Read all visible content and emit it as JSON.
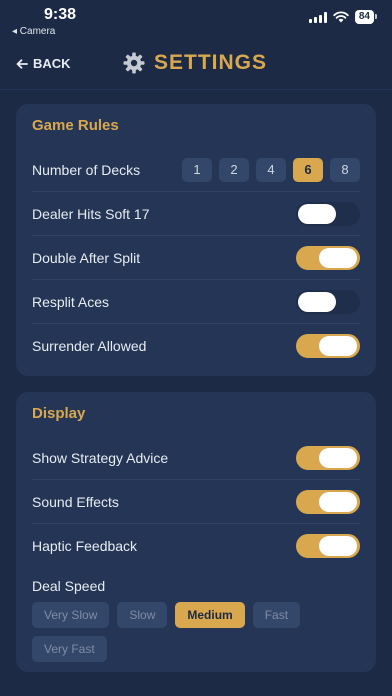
{
  "status_bar": {
    "time": "9:38",
    "back_app": "◂ Camera",
    "battery": "84"
  },
  "header": {
    "back_label": "BACK",
    "title": "SETTINGS",
    "accent_color": "#d9a84e"
  },
  "game_rules": {
    "title": "Game Rules",
    "decks": {
      "label": "Number of Decks",
      "options": [
        "1",
        "2",
        "4",
        "6",
        "8"
      ],
      "selected": "6"
    },
    "toggles": [
      {
        "label": "Dealer Hits Soft 17",
        "on": false
      },
      {
        "label": "Double After Split",
        "on": true
      },
      {
        "label": "Resplit Aces",
        "on": false
      },
      {
        "label": "Surrender Allowed",
        "on": true
      }
    ]
  },
  "display": {
    "title": "Display",
    "toggles": [
      {
        "label": "Show Strategy Advice",
        "on": true
      },
      {
        "label": "Sound Effects",
        "on": true
      },
      {
        "label": "Haptic Feedback",
        "on": true
      }
    ],
    "deal_speed": {
      "label": "Deal Speed",
      "options": [
        "Very Slow",
        "Slow",
        "Medium",
        "Fast",
        "Very Fast"
      ],
      "selected": "Medium"
    }
  }
}
